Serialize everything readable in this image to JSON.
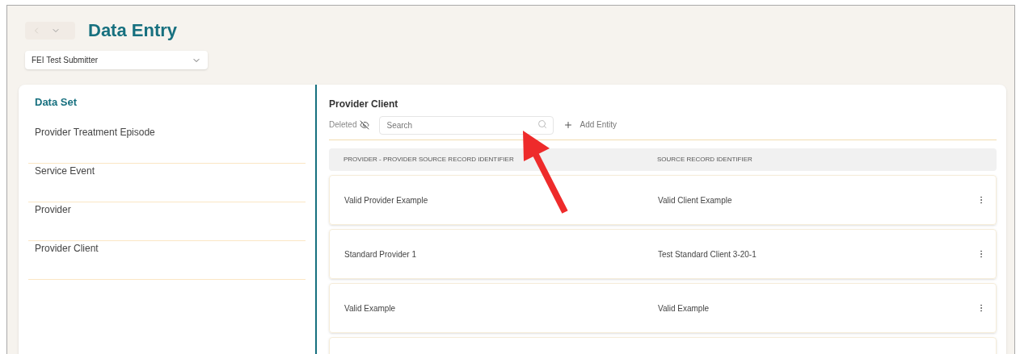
{
  "page": {
    "title": "Data Entry"
  },
  "submitter_select": {
    "value": "FEI Test Submitter"
  },
  "sidebar": {
    "title": "Data Set",
    "items": [
      {
        "label": "Provider Treatment Episode",
        "selected": false
      },
      {
        "label": "Service Event",
        "selected": false
      },
      {
        "label": "Provider",
        "selected": false
      },
      {
        "label": "Provider Client",
        "selected": false
      }
    ]
  },
  "panel": {
    "title": "Provider Client",
    "deleted_label": "Deleted",
    "search": {
      "placeholder": "Search"
    },
    "add_button": "Add Entity",
    "table": {
      "columns": [
        "PROVIDER - PROVIDER SOURCE RECORD IDENTIFIER",
        "SOURCE RECORD IDENTIFIER"
      ],
      "rows": [
        [
          "Valid Provider Example",
          "Valid Client Example"
        ],
        [
          "Standard Provider 1",
          "Test Standard Client 3-20-1"
        ],
        [
          "Valid Example",
          "Valid Example"
        ]
      ]
    }
  }
}
